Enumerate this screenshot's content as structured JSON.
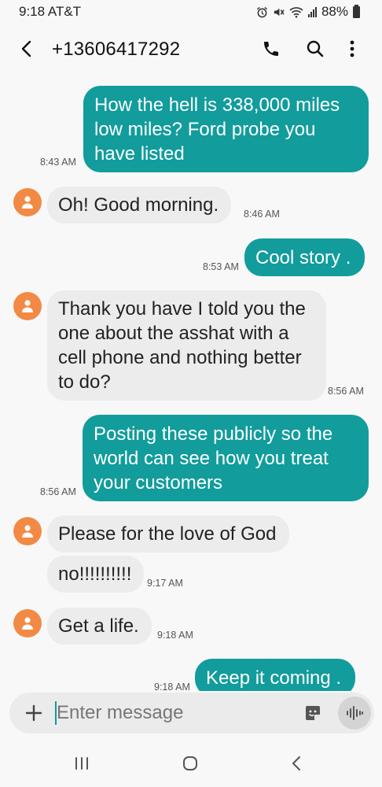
{
  "status": {
    "time": "9:18 AT&T",
    "battery": "88%"
  },
  "header": {
    "title": "+13606417292"
  },
  "messages": [
    {
      "direction": "out",
      "text": "How the hell is 338,000 miles low miles? Ford probe you have listed",
      "time": "8:43 AM"
    },
    {
      "direction": "in",
      "text": "Oh! Good morning.",
      "time": "8:46 AM"
    },
    {
      "direction": "out",
      "text": "Cool story .",
      "time": "8:53 AM"
    },
    {
      "direction": "in",
      "text": "Thank you have I told you the one about the asshat with a cell phone and nothing better to do?",
      "time": "8:56 AM"
    },
    {
      "direction": "out",
      "text": "Posting these publicly so the world can see how you treat your customers",
      "time": "8:56 AM"
    },
    {
      "direction": "in",
      "text": "Please for the love of God",
      "time": ""
    },
    {
      "direction": "in",
      "text": "no!!!!!!!!!!",
      "time": "9:17 AM"
    },
    {
      "direction": "in",
      "text": "Get a life.",
      "time": "9:18 AM"
    },
    {
      "direction": "out",
      "text": "Keep it coming .",
      "time": "9:18 AM"
    }
  ],
  "composer": {
    "placeholder": "Enter message"
  },
  "colors": {
    "outgoing_bubble": "#129c9c",
    "incoming_bubble": "#ececec",
    "avatar": "#f28a45",
    "background": "#f8f8f8"
  },
  "icons": {
    "back": "arrow-left-icon",
    "call": "phone-icon",
    "search": "search-icon",
    "more": "more-vertical-icon",
    "avatar": "person-icon",
    "attach": "plus-icon",
    "sticker": "sticker-icon",
    "voice": "voice-wave-icon",
    "nav_recents": "recents-icon",
    "nav_home": "home-icon",
    "nav_back": "back-chevron-icon"
  }
}
